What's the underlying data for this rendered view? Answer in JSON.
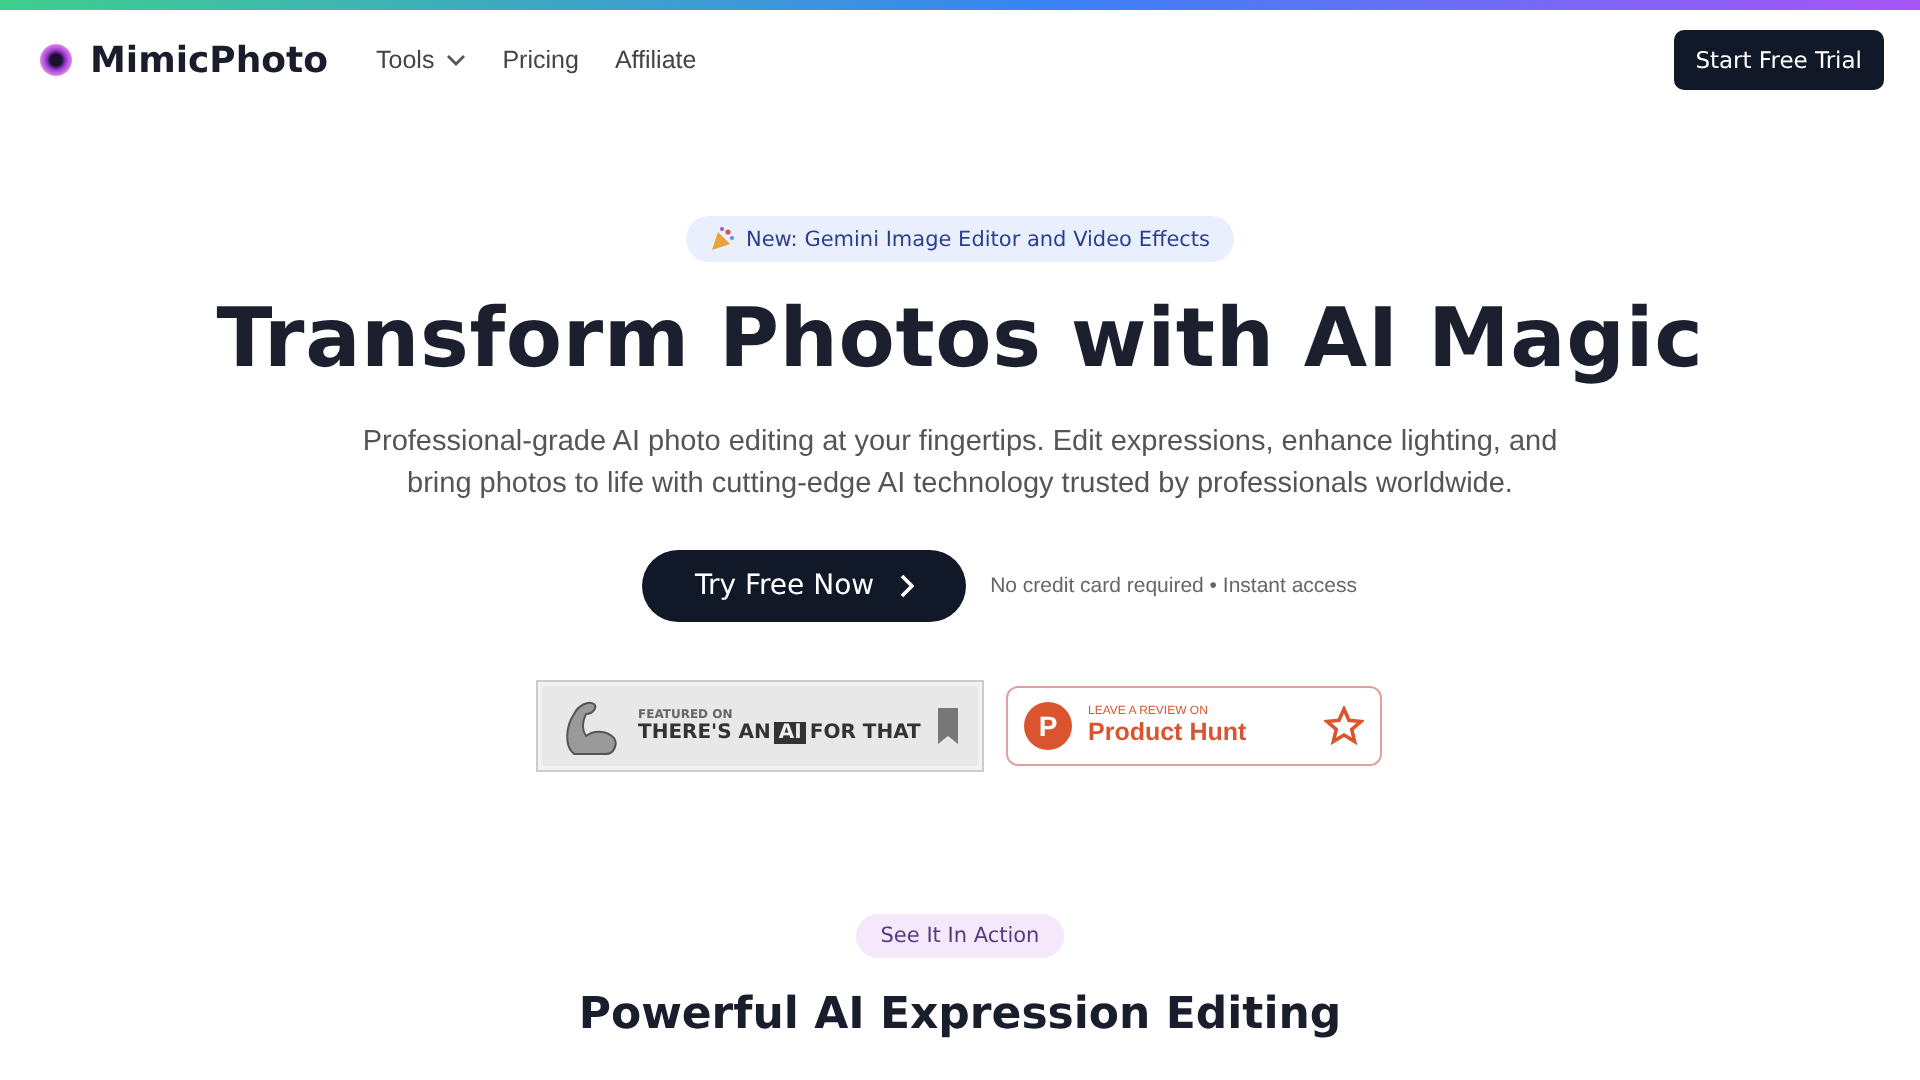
{
  "nav": {
    "brand": "MimicPhoto",
    "links": [
      {
        "label": "Tools",
        "kind": "dropdown"
      },
      {
        "label": "Pricing",
        "kind": "link"
      },
      {
        "label": "Affiliate",
        "kind": "link"
      }
    ],
    "cta": "Start Free Trial"
  },
  "hero": {
    "announcement": "New: Gemini Image Editor and Video Effects",
    "title": "Transform Photos with AI Magic",
    "subtitle": "Professional-grade AI photo editing at your fingertips. Edit expressions, enhance lighting, and bring photos to life with cutting-edge AI technology trusted by professionals worldwide.",
    "button": "Try Free Now",
    "note": "No credit card required • Instant access"
  },
  "badges": [
    {
      "kind": "taaft",
      "small": "FEATURED ON",
      "parts": [
        "THERE'S AN",
        "AI",
        "FOR THAT"
      ]
    },
    {
      "kind": "producthunt",
      "small": "LEAVE A REVIEW ON",
      "letter": "P",
      "name": "Product Hunt"
    }
  ],
  "section": {
    "pill": "See It In Action",
    "title": "Powerful AI Expression Editing"
  }
}
